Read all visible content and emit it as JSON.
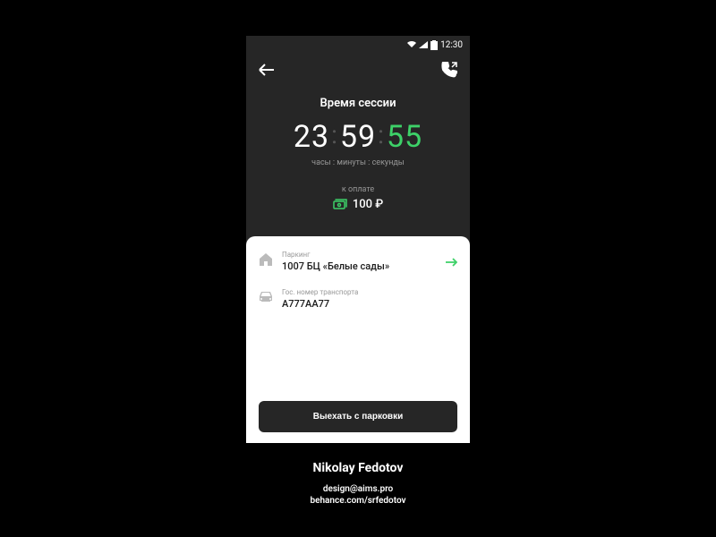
{
  "status_bar": {
    "time": "12:30"
  },
  "session": {
    "title": "Время сессии",
    "hours": "23",
    "minutes": "59",
    "seconds": "55",
    "labels": "часы : минуты : секунды",
    "payment_label": "к оплате",
    "payment_amount": "100 ₽"
  },
  "parking": {
    "label": "Паркинг",
    "value": "1007 БЦ «Белые сады»"
  },
  "vehicle": {
    "label": "Гос. номер транспорта",
    "value": "А777АА77"
  },
  "exit_button": "Выехать с парковки",
  "credits": {
    "name": "Nikolay Fedotov",
    "email": "design@aims.pro",
    "portfolio": "behance.com/srfedotov"
  }
}
